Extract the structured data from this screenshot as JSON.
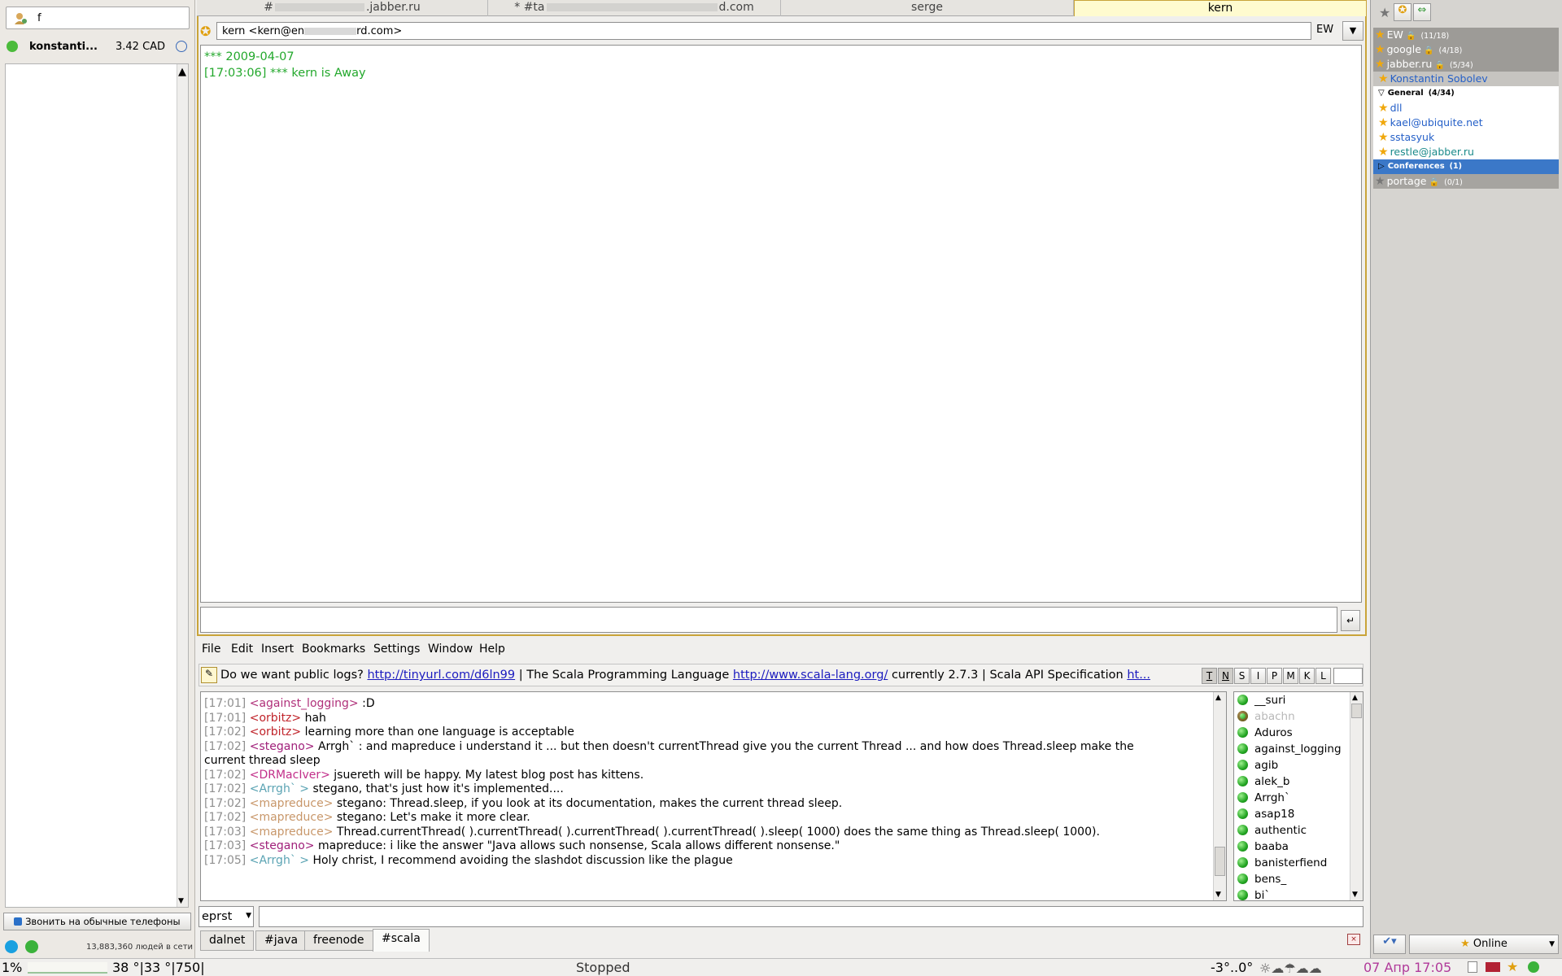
{
  "skype": {
    "search_value": "f",
    "user_name": "konstanti...",
    "credit": "3.42 CAD",
    "call_button": "Звонить на обычные телефоны",
    "online_count": "13,883,360 людей в сети"
  },
  "chat_tabs": [
    "#",
    ".jabber.ru",
    "* #ta",
    "d.com",
    "serge",
    "kern"
  ],
  "psi": {
    "header": "kern <kern@en",
    "header_tail": "rd.com>",
    "enc_label": "EW",
    "log": [
      {
        "text": "*** 2009-04-07"
      },
      {
        "text": "[17:03:06] *** kern is Away"
      }
    ]
  },
  "menu": [
    "File",
    "Edit",
    "Insert",
    "Bookmarks",
    "Settings",
    "Window",
    "Help"
  ],
  "topic": {
    "lead": "Do we want public logs?",
    "link1": "http://tinyurl.com/d6ln99",
    "mid": "| The Scala Programming Language",
    "link2": "http://www.scala-lang.org/",
    "tail": "currently 2.7.3 | Scala API Specification",
    "link3": "ht...",
    "modes": [
      "T",
      "N",
      "S",
      "I",
      "P",
      "M",
      "K",
      "L"
    ]
  },
  "log": [
    {
      "ts": "[17:01]",
      "nick": "<against_logging>",
      "nc": "#b0307a",
      "msg": ":D"
    },
    {
      "ts": "[17:01]",
      "nick": "<orbitz>",
      "nc": "#c0232a",
      "msg": "hah"
    },
    {
      "ts": "[17:02]",
      "nick": "<orbitz>",
      "nc": "#c0232a",
      "msg": "learning more than one language is acceptable"
    },
    {
      "ts": "[17:02]",
      "nick": "<stegano>",
      "nc": "#a0207a",
      "msg": "Arrgh` : and mapreduce i understand it ... but then doesn't currentThread give you the current Thread ... and how does Thread.sleep make the"
    },
    {
      "ts": "",
      "nick": "",
      "nc": "#000",
      "msg": "current thread sleep"
    },
    {
      "ts": "[17:02]",
      "nick": "<DRMacIver>",
      "nc": "#c22f8a",
      "msg": "jsuereth will be happy. My latest blog post has kittens."
    },
    {
      "ts": "[17:02]",
      "nick": "<Arrgh` >",
      "nc": "#5aa3b3",
      "msg": "stegano, that's just how it's implemented...."
    },
    {
      "ts": "[17:02]",
      "nick": "<mapreduce>",
      "nc": "#c8976a",
      "msg": "stegano: Thread.sleep, if you look at its documentation, makes the current thread sleep."
    },
    {
      "ts": "[17:02]",
      "nick": "<mapreduce>",
      "nc": "#c8976a",
      "msg": "stegano: Let's make it more clear."
    },
    {
      "ts": "[17:03]",
      "nick": "<mapreduce>",
      "nc": "#c8976a",
      "msg": "Thread.currentThread( ).currentThread( ).currentThread( ).currentThread( ).sleep( 1000) does the same thing as Thread.sleep( 1000)."
    },
    {
      "ts": "[17:03]",
      "nick": "<stegano>",
      "nc": "#a0207a",
      "msg": "mapreduce: i like the answer \"Java allows such nonsense, Scala allows different nonsense.\""
    },
    {
      "ts": "[17:05]",
      "nick": "<Arrgh` >",
      "nc": "#5aa3b3",
      "msg": "Holy christ, I recommend avoiding the slashdot discussion like the plague"
    }
  ],
  "users": [
    "__suri",
    "abachn",
    "Aduros",
    "against_logging",
    "agib",
    "alek_b",
    "Arrgh`",
    "asap18",
    "authentic",
    "baaba",
    "banisterfiend",
    "bens_",
    "bi`"
  ],
  "nick_input": "eprst",
  "server_tabs": [
    "dalnet",
    "#java",
    "freenode",
    "#scala"
  ],
  "roster": [
    {
      "label": "EW",
      "count": "(11/18)",
      "kind": "account",
      "color": "#fff"
    },
    {
      "label": "google",
      "count": "(4/18)",
      "kind": "account",
      "color": "#fff"
    },
    {
      "label": "jabber.ru",
      "count": "(5/34)",
      "kind": "account",
      "color": "#fff"
    },
    {
      "label": "Konstantin Sobolev",
      "count": "",
      "kind": "self",
      "color": "#2560c8"
    },
    {
      "label": "General",
      "count": "(4/34)",
      "kind": "group",
      "color": "#000"
    },
    {
      "label": "dll",
      "count": "",
      "kind": "contact",
      "color": "#2560c8"
    },
    {
      "label": "kael@ubiquite.net",
      "count": "",
      "kind": "contact",
      "color": "#2560c8"
    },
    {
      "label": "sstasyuk",
      "count": "",
      "kind": "contact",
      "color": "#2560c8"
    },
    {
      "label": "restle@jabber.ru",
      "count": "",
      "kind": "contact-away",
      "color": "#1a8a8a"
    },
    {
      "label": "Conferences",
      "count": "(1)",
      "kind": "group-sel",
      "color": "#fff"
    },
    {
      "label": "portage",
      "count": "(0/1)",
      "kind": "account-off",
      "color": "#fff"
    }
  ],
  "roster_status": "Online",
  "statusbar": {
    "cpu": "1%",
    "temps": "38 °|33 °|750|",
    "player": "Stopped",
    "weather": "-3°..0°",
    "datetime": "07 Апр 17:05"
  }
}
